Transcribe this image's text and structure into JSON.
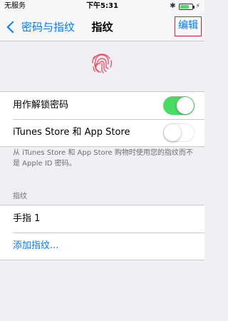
{
  "status_bar": {
    "carrier": "无服务",
    "time": "下午5:31",
    "bluetooth_icon": "bluetooth-icon",
    "battery_icon": "battery-charging-icon",
    "battery_level": 0.8
  },
  "nav": {
    "back_label": "密码与指纹",
    "title": "指纹",
    "edit_label": "编辑"
  },
  "fingerprint": {
    "icon": "fingerprint-icon",
    "color": "#e8546e"
  },
  "toggles": [
    {
      "label": "用作解锁密码",
      "on": true
    },
    {
      "label": "iTunes Store 和 App Store",
      "on": false
    }
  ],
  "footer_note": "从 iTunes Store 和 App Store 购物时使用您的指纹而不是 Apple ID 密码。",
  "fingerprints_section": {
    "header": "指纹",
    "items": [
      "手指 1"
    ],
    "add_label": "添加指纹..."
  },
  "colors": {
    "accent": "#007aff",
    "switch_on": "#4cd964",
    "highlight_box": "#d9232b"
  }
}
